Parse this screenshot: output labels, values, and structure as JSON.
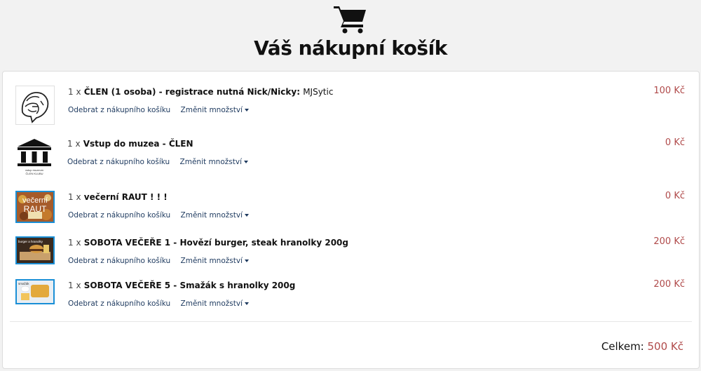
{
  "header": {
    "cart_icon": "shopping-cart-icon",
    "title": "Váš nákupní košík"
  },
  "items": [
    {
      "qty": "1 x",
      "title": "ČLEN (1 osoba) - registrace nutná Nick/Nicky:",
      "nick": "MJSytic",
      "remove_label": "Odebrat z nákupního košíku",
      "change_label": "Změnit množství",
      "price": "100 Kč",
      "image": "lion-logo"
    },
    {
      "qty": "1 x",
      "title": "Vstup do muzea - ČLEN",
      "nick": "",
      "remove_label": "Odebrat z nákupního košíku",
      "change_label": "Změnit množství",
      "price": "0 Kč",
      "image": "museum-building-icon",
      "image_caption_1": "vstup muzeum",
      "image_caption_2": "ČLEN KLUBU"
    },
    {
      "qty": "1 x",
      "title": "večerní RAUT ! ! !",
      "nick": "",
      "remove_label": "Odebrat z nákupního košíku",
      "change_label": "Změnit množství",
      "price": "0 Kč",
      "image": "buffet-photo",
      "image_text_1": "večerní",
      "image_text_2": "RAUT"
    },
    {
      "qty": "1 x",
      "title": "SOBOTA VEČEŘE 1 - Hovězí burger, steak hranolky 200g",
      "nick": "",
      "remove_label": "Odebrat z nákupního košíku",
      "change_label": "Změnit množství",
      "price": "200 Kč",
      "image": "burger-photo",
      "image_text": "burger a hranolky"
    },
    {
      "qty": "1 x",
      "title": "SOBOTA VEČEŘE 5 - Smažák s hranolky 200g",
      "nick": "",
      "remove_label": "Odebrat z nákupního košíku",
      "change_label": "Změnit množství",
      "price": "200 Kč",
      "image": "fried-cheese-photo",
      "image_text": "smažák"
    }
  ],
  "summary": {
    "label": "Celkem:",
    "total": "500 Kč"
  },
  "colors": {
    "price": "#b04a4a",
    "link": "#1e3a5f",
    "thumb_border": "#1a8fd6"
  }
}
